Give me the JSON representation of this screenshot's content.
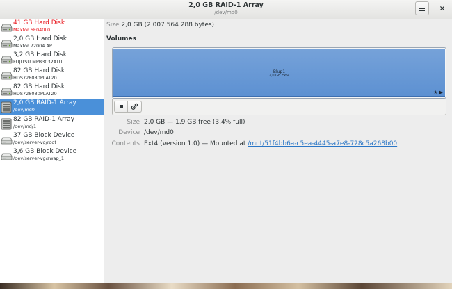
{
  "window": {
    "title": "2,0 GB RAID-1 Array",
    "subtitle": "/dev/md0"
  },
  "header": {
    "menu_icon": "hamburger-menu-icon",
    "close_label": "×"
  },
  "sidebar": {
    "items": [
      {
        "name": "41 GB Hard Disk",
        "sub": "Maxtor 6E040L0",
        "icon": "hard-disk-icon",
        "warning": true,
        "selected": false
      },
      {
        "name": "2,0 GB Hard Disk",
        "sub": "Maxtor 72004 AP",
        "icon": "hard-disk-icon",
        "warning": false,
        "selected": false
      },
      {
        "name": "3,2 GB Hard Disk",
        "sub": "FUJITSU MPB3032ATU",
        "icon": "hard-disk-icon",
        "warning": false,
        "selected": false
      },
      {
        "name": "82 GB Hard Disk",
        "sub": "HDS728080PLAT20",
        "icon": "hard-disk-icon",
        "warning": false,
        "selected": false
      },
      {
        "name": "82 GB Hard Disk",
        "sub": "HDS728080PLAT20",
        "icon": "hard-disk-icon",
        "warning": false,
        "selected": false
      },
      {
        "name": "2,0 GB RAID-1 Array",
        "sub": "/dev/md0",
        "icon": "raid-array-icon",
        "warning": false,
        "selected": true
      },
      {
        "name": "82 GB RAID-1 Array",
        "sub": "/dev/md/1",
        "icon": "raid-array-icon",
        "warning": false,
        "selected": false
      },
      {
        "name": "37 GB Block Device",
        "sub": "/dev/server-vg/root",
        "icon": "block-device-icon",
        "warning": false,
        "selected": false
      },
      {
        "name": "3,6 GB Block Device",
        "sub": "/dev/server-vg/swap_1",
        "icon": "block-device-icon",
        "warning": false,
        "selected": false
      }
    ]
  },
  "main": {
    "size_label": "Size",
    "size_value": "2,0 GB (2 007 564 288 bytes)",
    "volumes_heading": "Volumes",
    "partition": {
      "name": "Blup1",
      "info": "2,0 GB Ext4",
      "flags": "★ ▶"
    },
    "toolbar": {
      "stop_icon": "stop-icon",
      "settings_icon": "gears-icon"
    },
    "props": {
      "size_label": "Size",
      "size_value": "2,0 GB — 1,9 GB free (3,4% full)",
      "device_label": "Device",
      "device_value": "/dev/md0",
      "contents_label": "Contents",
      "contents_prefix": "Ext4 (version 1.0) — Mounted at ",
      "contents_link": "/mnt/51f4bb6a-c5ea-4445-a7e8-728c5a268b00"
    }
  },
  "colors": {
    "accent": "#4a90d9",
    "warning": "#e8141b",
    "partition": "#6b9bd8",
    "link": "#2a76c6"
  }
}
